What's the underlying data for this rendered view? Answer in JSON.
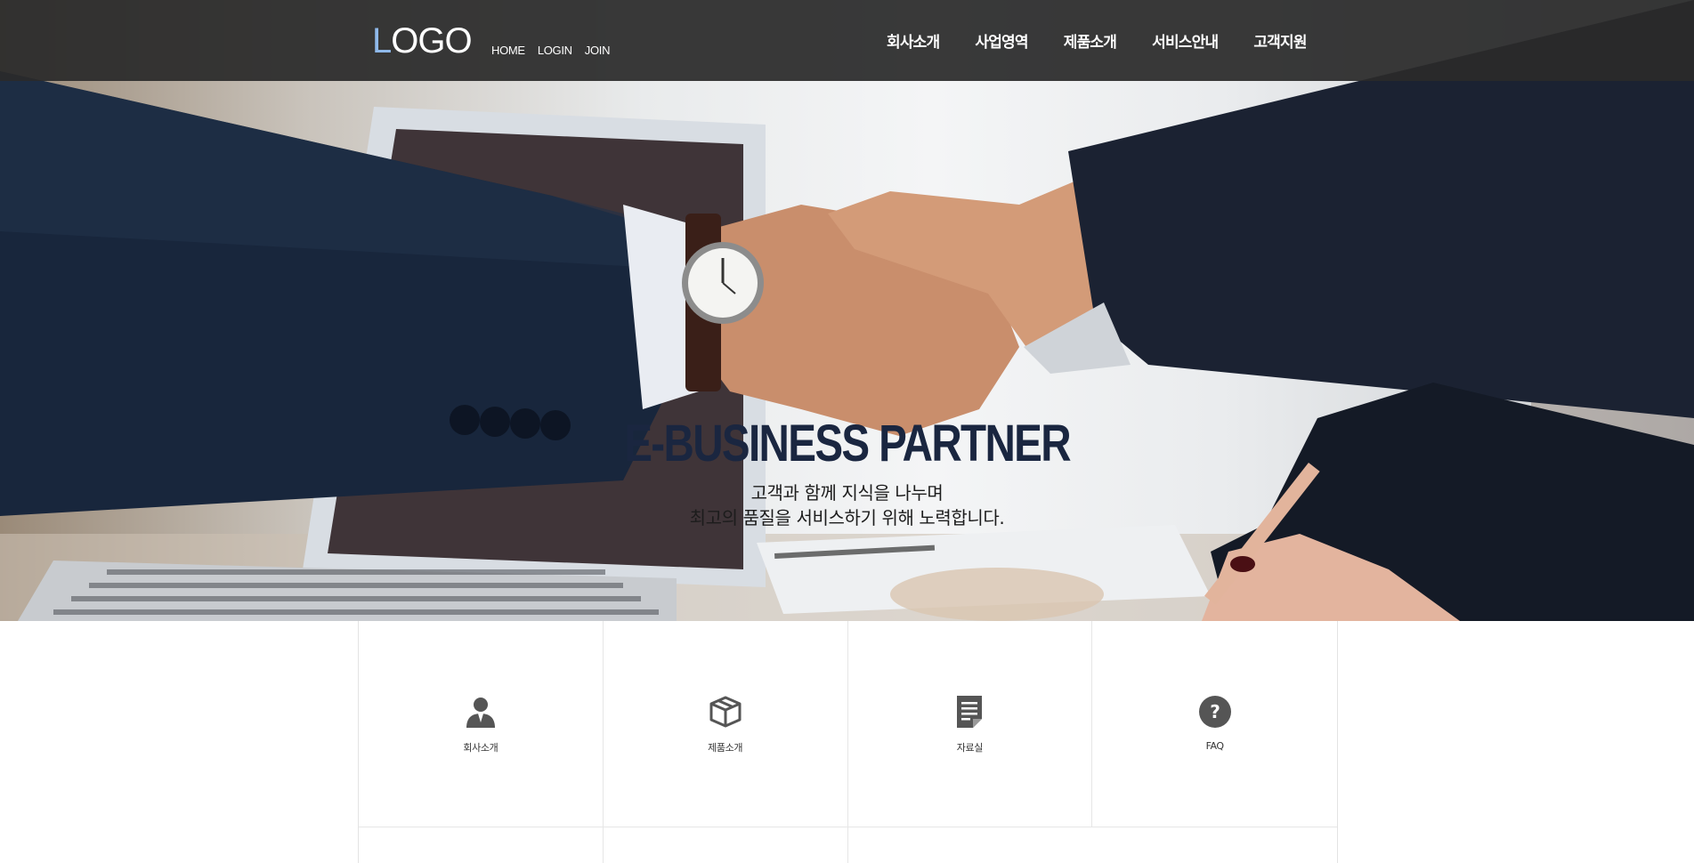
{
  "header": {
    "logo_first": "L",
    "logo_rest": "OGO",
    "util_links": [
      "HOME",
      "LOGIN",
      "JOIN"
    ],
    "nav": [
      "회사소개",
      "사업영역",
      "제품소개",
      "서비스안내",
      "고객지원"
    ]
  },
  "hero": {
    "title": "E-BUSINESS PARTNER",
    "subtitle_line1": "고객과 함께 지식을 나누며",
    "subtitle_line2": "최고의 품질을 서비스하기 위해 노력합니다.",
    "image": "business-handshake-photo"
  },
  "quick_menu": [
    {
      "label": "회사소개",
      "icon": "person-icon"
    },
    {
      "label": "제품소개",
      "icon": "box-icon"
    },
    {
      "label": "자료실",
      "icon": "document-icon"
    },
    {
      "label": "FAQ",
      "icon": "question-icon"
    }
  ],
  "colors": {
    "header_bg": "#2a2a2a",
    "logo_accent": "#8fb9ea",
    "hero_title": "#1a2640",
    "icon_gray": "#555555",
    "grid_border": "#e6e6e6"
  }
}
